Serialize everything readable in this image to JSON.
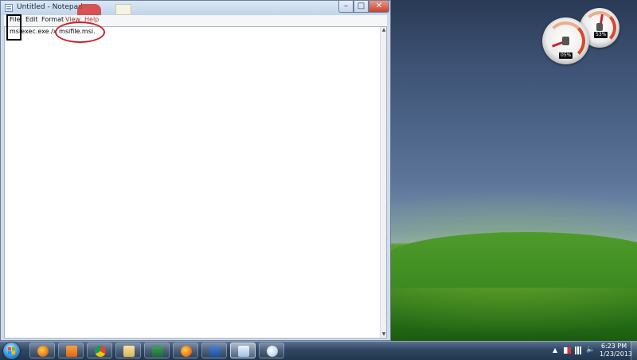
{
  "window": {
    "title": "Untitled - Notepad",
    "controls": {
      "minimize": "–",
      "maximize": "□",
      "close": "✕"
    }
  },
  "menubar": {
    "items": [
      "File",
      "Edit",
      "Format",
      "View",
      "Help"
    ]
  },
  "editor": {
    "content": "msiexec.exe /x msifile.msi."
  },
  "annotations": {
    "box_color": "#000000",
    "ellipse_color": "#c8242c"
  },
  "gadgets": {
    "cpu_meter": {
      "readout": "05%",
      "icon": "cpu-meter-gauge-icon"
    },
    "memory_meter": {
      "readout": "53%",
      "icon": "memory-meter-gauge-icon"
    }
  },
  "taskbar": {
    "start_icon": "windows-start-orb-icon",
    "pinned": [
      {
        "name": "taskbar-firefox",
        "icon": "firefox-icon"
      },
      {
        "name": "taskbar-media-player",
        "icon": "media-player-icon"
      },
      {
        "name": "taskbar-chrome",
        "icon": "chrome-icon"
      },
      {
        "name": "taskbar-explorer",
        "icon": "folder-icon"
      },
      {
        "name": "taskbar-excel",
        "icon": "excel-icon"
      },
      {
        "name": "taskbar-firefox-2",
        "icon": "firefox-icon"
      },
      {
        "name": "taskbar-word",
        "icon": "word-icon"
      },
      {
        "name": "taskbar-notepad",
        "icon": "notepad-icon"
      },
      {
        "name": "taskbar-paint",
        "icon": "paint-icon"
      }
    ],
    "tray": {
      "show_hidden": "▲",
      "volume": "🔈",
      "time": "6:23 PM",
      "date": "1/23/2013"
    }
  },
  "colors": {
    "taskbar": "#2f4663",
    "close_button": "#c8432e",
    "annotation_red": "#c8242c"
  }
}
